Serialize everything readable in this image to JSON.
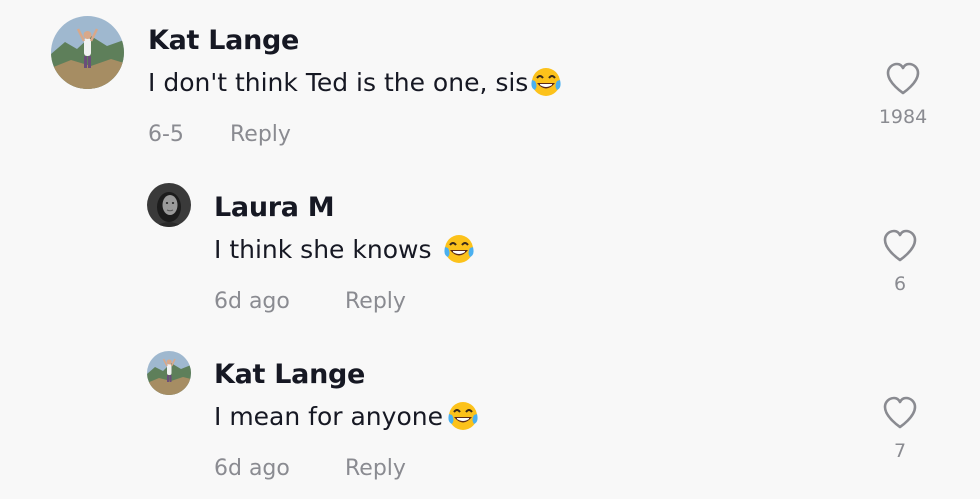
{
  "comments": [
    {
      "author": "Kat Lange",
      "text": "I don't think Ted is the one, sis",
      "emoji": "face-with-tears-of-joy",
      "date": "6-5",
      "reply_label": "Reply",
      "likes": "1984"
    },
    {
      "author": "Laura M",
      "text": "I think she knows",
      "emoji": "face-with-tears-of-joy",
      "date": "6d ago",
      "reply_label": "Reply",
      "likes": "6"
    },
    {
      "author": "Kat Lange",
      "text": "I mean for anyone",
      "emoji": "face-with-tears-of-joy",
      "date": "6d ago",
      "reply_label": "Reply",
      "likes": "7"
    }
  ],
  "colors": {
    "background": "#f8f8f8",
    "primary_text": "#161823",
    "secondary_text": "#8a8b91"
  }
}
